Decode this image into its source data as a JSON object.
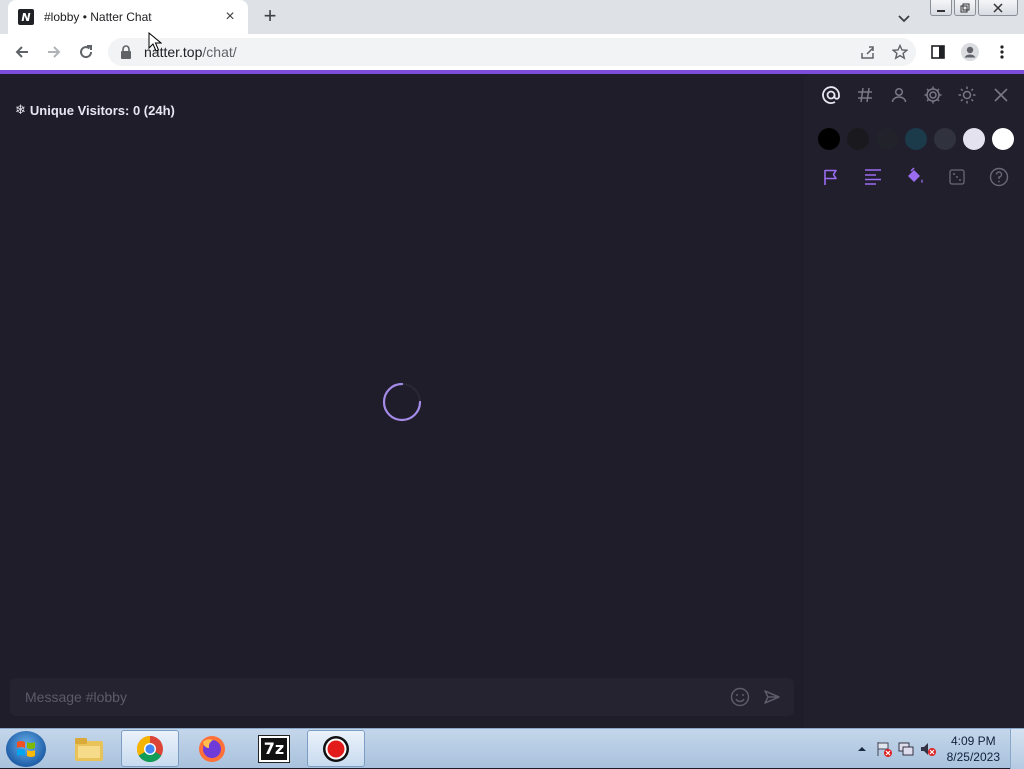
{
  "browser": {
    "tab_title": "#lobby • Natter Chat",
    "favicon_letter": "N",
    "url_host": "natter.top",
    "url_path": "/chat/"
  },
  "app": {
    "visitors_icon": "❄",
    "visitors_text": "Unique Visitors: 0 (24h)",
    "composer_placeholder": "Message #lobby",
    "accent_color": "#7c4ddb"
  },
  "sidebar": {
    "top_icons": [
      "at-icon",
      "hash-icon",
      "user-icon",
      "gear-icon",
      "sun-icon",
      "close-icon"
    ],
    "swatches": [
      "#000000",
      "#1a1a1e",
      "#22222a",
      "#1b3a4a",
      "#30323e",
      "#e4e2ee",
      "#ffffff"
    ],
    "tool_icons": [
      "flag-icon",
      "align-left-icon",
      "paint-bucket-icon",
      "dice-icon",
      "help-icon"
    ]
  },
  "taskbar": {
    "time": "4:09 PM",
    "date": "8/25/2023",
    "app_7z_label": "7z"
  }
}
